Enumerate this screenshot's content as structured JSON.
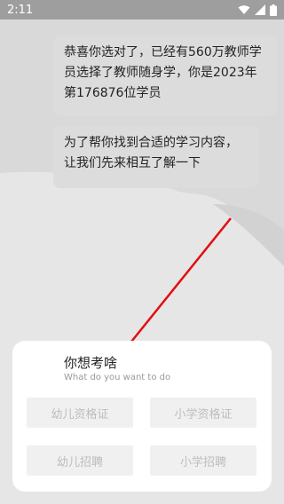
{
  "status": {
    "time": "2:11"
  },
  "chat": {
    "msg1": "恭喜你选对了，已经有560万教师学员选择了教师随身学，你是2023年第176876位学员",
    "msg2": "为了帮你找到合适的学习内容，让我们先来相互了解一下"
  },
  "sheet": {
    "title": "你想考啥",
    "subtitle": "What do you want to do",
    "options": [
      "幼儿资格证",
      "小学资格证",
      "幼儿招聘",
      "小学招聘"
    ]
  },
  "icons": [
    "wifi-icon",
    "signal-icon",
    "battery-icon"
  ],
  "colors": {
    "arrow": "#e01010"
  }
}
